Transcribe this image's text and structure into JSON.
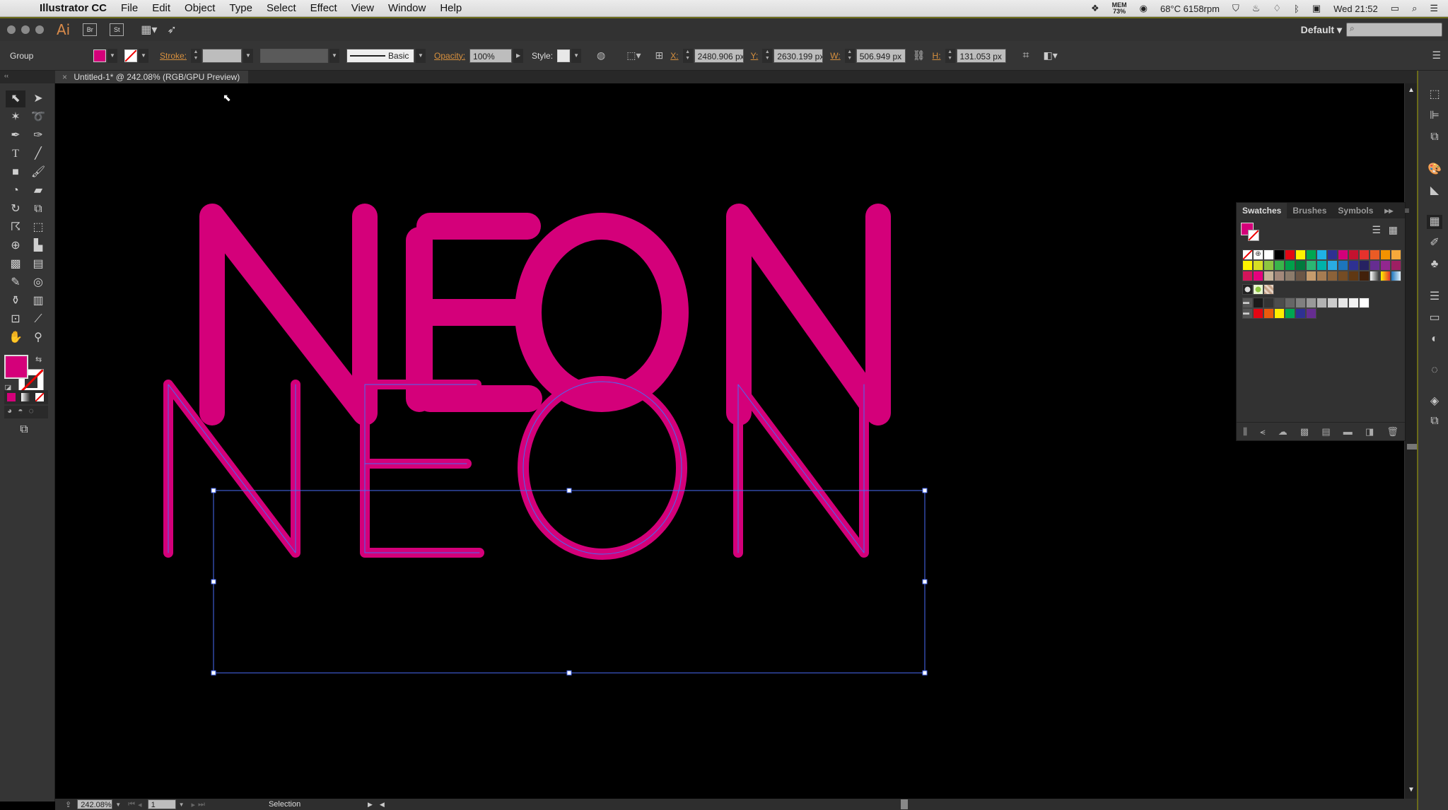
{
  "menubar": {
    "apple_icon": "apple-icon",
    "app_name": "Illustrator CC",
    "items": [
      "File",
      "Edit",
      "Object",
      "Type",
      "Select",
      "Effect",
      "View",
      "Window",
      "Help"
    ],
    "status": {
      "mem_label": "MEM",
      "mem_value": "73%",
      "temp": "68°C 6158rpm",
      "clock": "Wed 21:52"
    }
  },
  "appbar": {
    "logo": "Ai",
    "bridge": "Br",
    "stock": "St",
    "workspace": "Default ▾",
    "search_placeholder": ""
  },
  "control": {
    "selection_type": "Group",
    "fill_color": "#d4007a",
    "stroke_label": "Stroke:",
    "stroke_value": "",
    "brush_label": "Basic",
    "opacity_label": "Opacity:",
    "opacity_value": "100%",
    "style_label": "Style:",
    "x_label": "X:",
    "x_value": "2480.906 px",
    "y_label": "Y:",
    "y_value": "2630.199 px",
    "w_label": "W:",
    "w_value": "506.949 px",
    "h_label": "H:",
    "h_value": "131.053 px"
  },
  "document": {
    "tab_title": "Untitled-1* @ 242.08% (RGB/GPU Preview)",
    "close": "×"
  },
  "artwork": {
    "text": "NEON",
    "color": "#d4007a",
    "selection_color": "#4a6cf7"
  },
  "swatches_panel": {
    "tabs": [
      "Swatches",
      "Brushes",
      "Symbols"
    ],
    "active_tab": "Swatches",
    "rows": [
      [
        "none",
        "registration",
        "#ffffff",
        "#000000",
        "#e30613",
        "#fff200",
        "#00a651",
        "#1fb1e6",
        "#2e3192",
        "#d4007a",
        "#c4122f",
        "#e5322d",
        "#ea5b25",
        "#f39200",
        "#f5a93b"
      ],
      [
        "#fff200",
        "#d7df23",
        "#8dc63f",
        "#39b54a",
        "#00a14b",
        "#007a3d",
        "#2bb673",
        "#00b2a9",
        "#29abe2",
        "#1c75bc",
        "#2e3192",
        "#262262",
        "#662d91",
        "#92278f",
        "#9e1f63"
      ],
      [
        "#d4145a",
        "#e6007e",
        "#c7b299",
        "#a3887a",
        "#8c7b6b",
        "#6b5646",
        "#c69c6d",
        "#a67c52",
        "#8c6239",
        "#754c24",
        "#603813",
        "#42210b",
        "gradient-bw",
        "gradient-orange",
        "gradient-blue"
      ],
      [
        "pattern-dots",
        "pattern-green",
        "pattern-tan"
      ],
      [
        "folder",
        "#1a1a1a",
        "#333333",
        "#4d4d4d",
        "#666666",
        "#808080",
        "#999999",
        "#b3b3b3",
        "#cccccc",
        "#e6e6e6",
        "#f2f2f2",
        "#ffffff"
      ],
      [
        "folder",
        "#e30613",
        "#ea5b0c",
        "#ffed00",
        "#00a651",
        "#2e3192",
        "#662d91"
      ]
    ]
  },
  "statusbar": {
    "zoom": "242.08%",
    "artboard": "1",
    "tool": "Selection"
  }
}
